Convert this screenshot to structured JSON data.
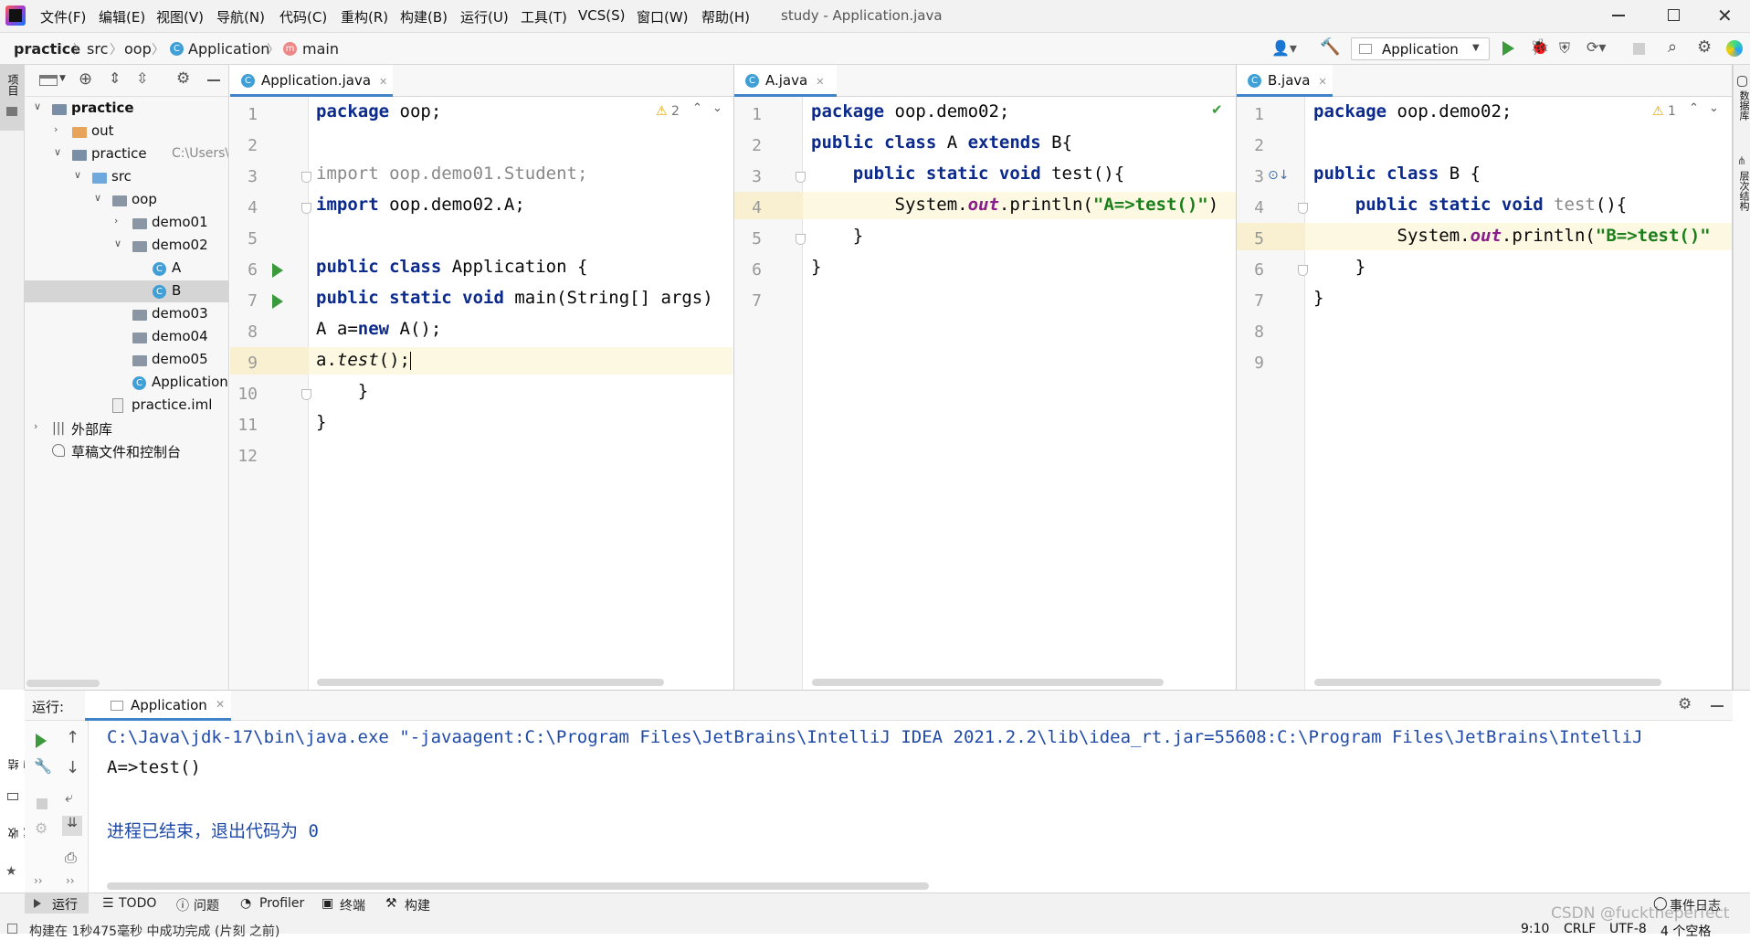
{
  "window": {
    "title": "study - Application.java",
    "menu": [
      "文件(F)",
      "编辑(E)",
      "视图(V)",
      "导航(N)",
      "代码(C)",
      "重构(R)",
      "构建(B)",
      "运行(U)",
      "工具(T)",
      "VCS(S)",
      "窗口(W)",
      "帮助(H)"
    ]
  },
  "breadcrumb": [
    "practice",
    "src",
    "oop",
    "Application",
    "main"
  ],
  "toolbar": {
    "run_config": "Application"
  },
  "left_strip": {
    "project_label": "项目",
    "structure_label": "结构",
    "favorites_label": "收藏夹"
  },
  "right_strip": {
    "database_label": "数据库",
    "hierarchy_label": "层次结构"
  },
  "project_tree": [
    {
      "label": "practice",
      "depth": 0,
      "expanded": true,
      "kind": "module-root",
      "bold": true
    },
    {
      "label": "out",
      "depth": 1,
      "expanded": false,
      "kind": "folder-orange"
    },
    {
      "label": "practice",
      "depth": 1,
      "expanded": true,
      "kind": "module",
      "hint": "C:\\Users\\wo"
    },
    {
      "label": "src",
      "depth": 2,
      "expanded": true,
      "kind": "folder-blue"
    },
    {
      "label": "oop",
      "depth": 3,
      "expanded": true,
      "kind": "package"
    },
    {
      "label": "demo01",
      "depth": 4,
      "expanded": false,
      "kind": "package"
    },
    {
      "label": "demo02",
      "depth": 4,
      "expanded": true,
      "kind": "package"
    },
    {
      "label": "A",
      "depth": 5,
      "kind": "class"
    },
    {
      "label": "B",
      "depth": 5,
      "kind": "class",
      "selected": true
    },
    {
      "label": "demo03",
      "depth": 4,
      "kind": "package"
    },
    {
      "label": "demo04",
      "depth": 4,
      "kind": "package"
    },
    {
      "label": "demo05",
      "depth": 4,
      "kind": "package"
    },
    {
      "label": "Application",
      "depth": 4,
      "kind": "class"
    },
    {
      "label": "practice.iml",
      "depth": 3,
      "kind": "iml"
    },
    {
      "label": "外部库",
      "depth": 0,
      "expanded": false,
      "kind": "library"
    },
    {
      "label": "草稿文件和控制台",
      "depth": 0,
      "kind": "scratch"
    }
  ],
  "editors": [
    {
      "tab": "Application.java",
      "warning_count": "2",
      "lines": [
        "1",
        "2",
        "3",
        "4",
        "5",
        "6",
        "7",
        "8",
        "9",
        "10",
        "11",
        "12"
      ],
      "code": [
        [
          {
            "t": "package ",
            "c": "kw"
          },
          {
            "t": "oop;",
            "c": ""
          }
        ],
        [],
        [
          {
            "t": "import oop.demo01.Student;",
            "c": "gray"
          }
        ],
        [
          {
            "t": "import ",
            "c": "kw"
          },
          {
            "t": "oop.demo02.A;",
            "c": ""
          }
        ],
        [],
        [
          {
            "t": "public class ",
            "c": "kw"
          },
          {
            "t": "Application {",
            "c": ""
          }
        ],
        [
          {
            "t": "public static void ",
            "c": "kw"
          },
          {
            "t": "main(String[] args)",
            "c": ""
          }
        ],
        [
          {
            "t": "A a=",
            "c": ""
          },
          {
            "t": "new ",
            "c": "kw"
          },
          {
            "t": "A();",
            "c": ""
          }
        ],
        [
          {
            "t": "a.",
            "c": ""
          },
          {
            "t": "test",
            "c": "call"
          },
          {
            "t": "();",
            "c": ""
          }
        ],
        [
          {
            "t": "    }",
            "c": ""
          }
        ],
        [
          {
            "t": "}",
            "c": ""
          }
        ],
        []
      ]
    },
    {
      "tab": "A.java",
      "lines": [
        "1",
        "2",
        "3",
        "4",
        "5",
        "6",
        "7"
      ],
      "code": [
        [
          {
            "t": "package ",
            "c": "kw"
          },
          {
            "t": "oop.demo02;",
            "c": ""
          }
        ],
        [
          {
            "t": "public class ",
            "c": "kw"
          },
          {
            "t": "A ",
            "c": ""
          },
          {
            "t": "extends ",
            "c": "kw"
          },
          {
            "t": "B{",
            "c": ""
          }
        ],
        [
          {
            "t": "    public static void ",
            "c": "kw"
          },
          {
            "t": "test(){",
            "c": ""
          }
        ],
        [
          {
            "t": "        System.",
            "c": ""
          },
          {
            "t": "out",
            "c": "field"
          },
          {
            "t": ".println(",
            "c": ""
          },
          {
            "t": "\"A=>test()\"",
            "c": "str"
          },
          {
            "t": ")",
            "c": ""
          }
        ],
        [
          {
            "t": "    }",
            "c": ""
          }
        ],
        [
          {
            "t": "}",
            "c": ""
          }
        ],
        []
      ]
    },
    {
      "tab": "B.java",
      "warning_count": "1",
      "lines": [
        "1",
        "2",
        "3",
        "4",
        "5",
        "6",
        "7",
        "8",
        "9"
      ],
      "code": [
        [
          {
            "t": "package ",
            "c": "kw"
          },
          {
            "t": "oop.demo02;",
            "c": ""
          }
        ],
        [],
        [
          {
            "t": "public class ",
            "c": "kw"
          },
          {
            "t": "B {",
            "c": ""
          }
        ],
        [
          {
            "t": "    public static void ",
            "c": "kw"
          },
          {
            "t": "test",
            "c": "gray"
          },
          {
            "t": "(){",
            "c": ""
          }
        ],
        [
          {
            "t": "        System.",
            "c": ""
          },
          {
            "t": "out",
            "c": "field"
          },
          {
            "t": ".println(",
            "c": ""
          },
          {
            "t": "\"B=>test()\"",
            "c": "str"
          }
        ],
        [
          {
            "t": "    }",
            "c": ""
          }
        ],
        [
          {
            "t": "}",
            "c": ""
          }
        ],
        [],
        []
      ]
    }
  ],
  "run_panel": {
    "label": "运行:",
    "tab": "Application",
    "output": [
      "C:\\Java\\jdk-17\\bin\\java.exe \"-javaagent:C:\\Program Files\\JetBrains\\IntelliJ IDEA 2021.2.2\\lib\\idea_rt.jar=55608:C:\\Program Files\\JetBrains\\IntelliJ",
      "A=>test()",
      "",
      "进程已结束，退出代码为 0"
    ]
  },
  "bottom_tabs": [
    "运行",
    "TODO",
    "问题",
    "Profiler",
    "终端",
    "构建"
  ],
  "event_log": "事件日志",
  "watermark": "CSDN @fucktheperfect",
  "status": {
    "message": "构建在 1秒475毫秒 中成功完成 (片刻 之前)",
    "position": "9:10",
    "line_ending": "CRLF",
    "encoding": "UTF-8",
    "indent": "4 个空格"
  }
}
